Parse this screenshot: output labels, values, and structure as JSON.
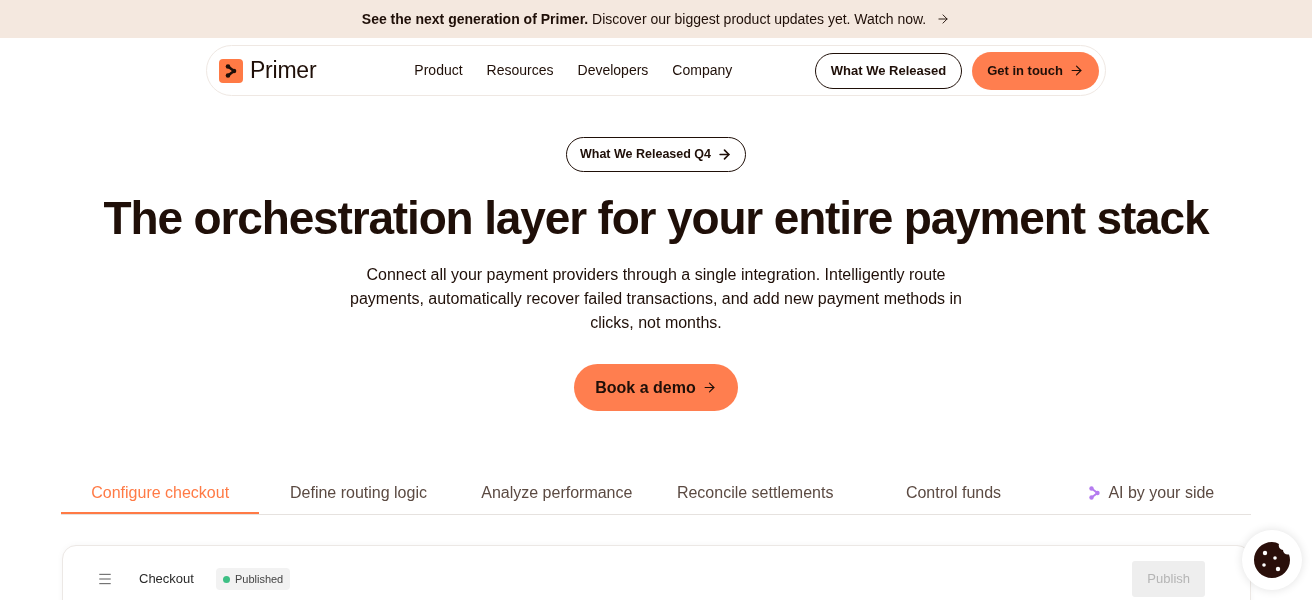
{
  "banner": {
    "text": "**See the next generation of Primer.** Discover our biggest product updates yet. Watch now."
  },
  "nav": {
    "brand": "Primer",
    "links": [
      "Product",
      "Resources",
      "Developers",
      "Company"
    ],
    "buttons": [
      {
        "label": "What We Released",
        "kind": "outline"
      },
      {
        "label": "Get in touch",
        "kind": "primary"
      }
    ]
  },
  "hero": {
    "pill": "What We Released Q4",
    "title": "The orchestration layer for your entire payment stack",
    "description": "Connect all your payment providers through a single integration. Intelligently route payments, automatically recover failed transactions, and add new payment methods in clicks, not months.",
    "cta": "Book a demo"
  },
  "tabs": [
    {
      "label": "Configure checkout",
      "selected": true,
      "kind": "plain"
    },
    {
      "label": "Define routing logic",
      "selected": false,
      "kind": "plain"
    },
    {
      "label": "Analyze performance",
      "selected": false,
      "kind": "plain"
    },
    {
      "label": "Reconcile settlements",
      "selected": false,
      "kind": "plain"
    },
    {
      "label": "Control funds",
      "selected": false,
      "kind": "plain"
    },
    {
      "label": "AI by your side",
      "selected": false,
      "kind": "ai"
    }
  ],
  "checkout_panel": {
    "title": "Checkout",
    "status": "Published",
    "publish_button": {
      "label": "Publish",
      "disabled": true
    }
  }
}
